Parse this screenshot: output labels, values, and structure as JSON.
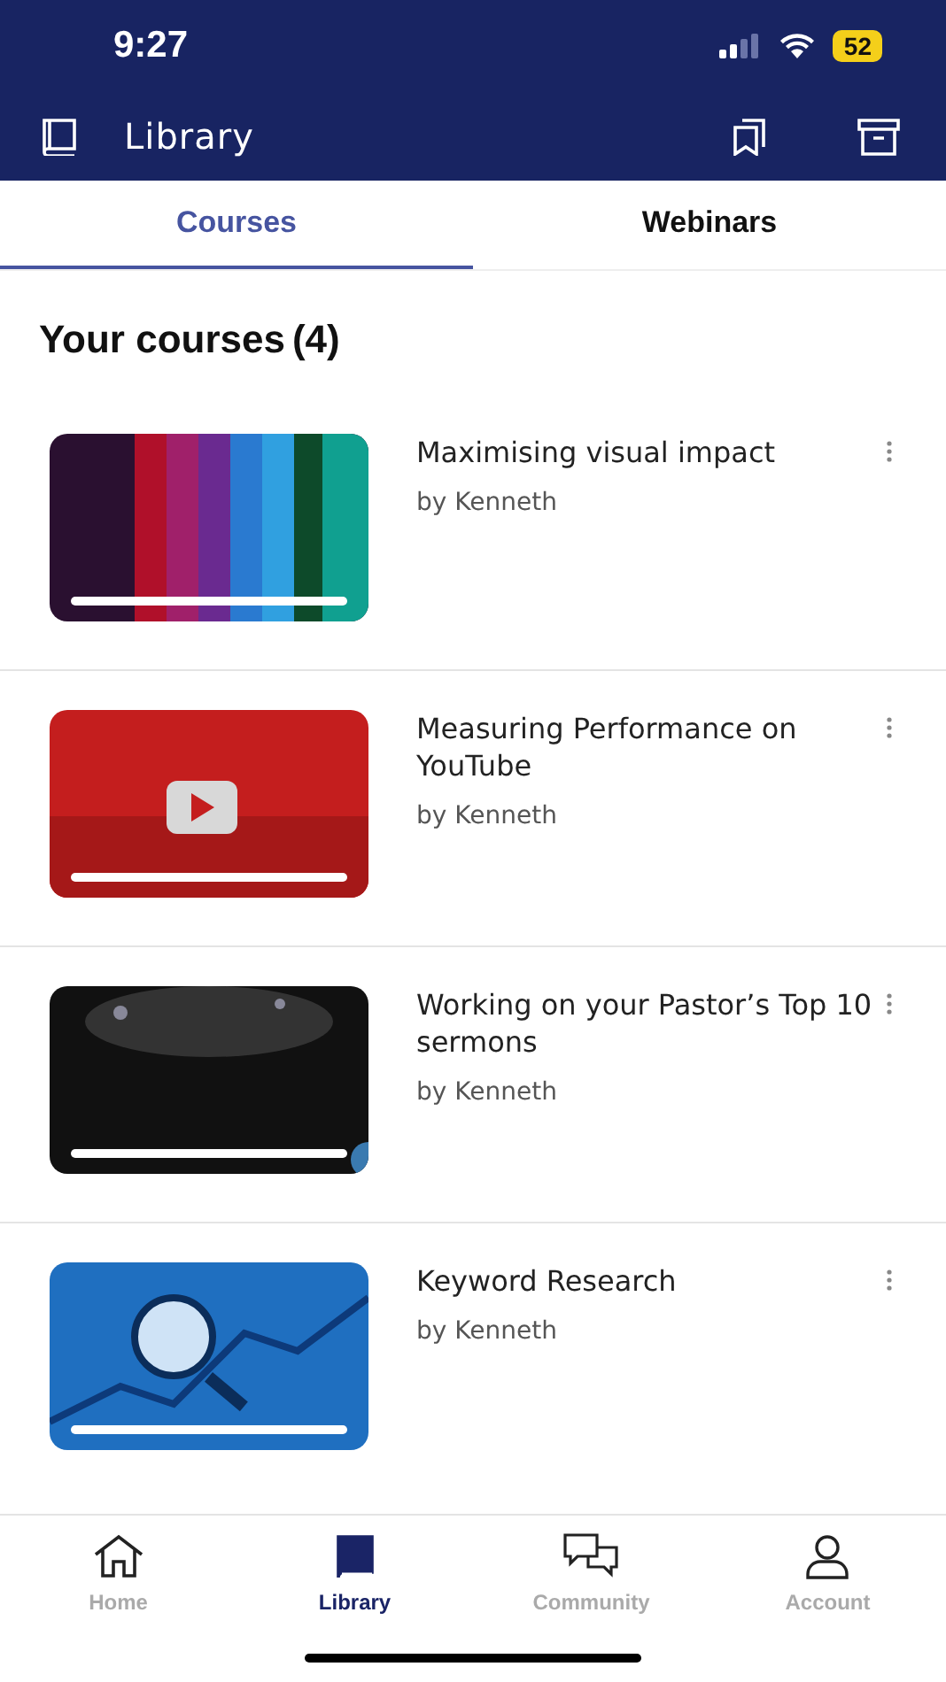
{
  "status_bar": {
    "time": "9:27",
    "battery": "52"
  },
  "header": {
    "title": "Library"
  },
  "tabs": [
    {
      "label": "Courses",
      "selected": true
    },
    {
      "label": "Webinars",
      "selected": false
    }
  ],
  "section": {
    "title": "Your courses",
    "count": "(4)"
  },
  "courses": [
    {
      "title": "Maximising visual impact",
      "author": "by Kenneth"
    },
    {
      "title": "Measuring Performance on YouTube",
      "author": "by Kenneth"
    },
    {
      "title": "Working on your Pastor’s Top 10 sermons",
      "author": "by Kenneth"
    },
    {
      "title": "Keyword Research",
      "author": "by Kenneth"
    }
  ],
  "nav": [
    {
      "label": "Home",
      "selected": false,
      "kind": "home"
    },
    {
      "label": "Library",
      "selected": true,
      "kind": "library"
    },
    {
      "label": "Community",
      "selected": false,
      "kind": "community"
    },
    {
      "label": "Account",
      "selected": false,
      "kind": "account"
    }
  ]
}
